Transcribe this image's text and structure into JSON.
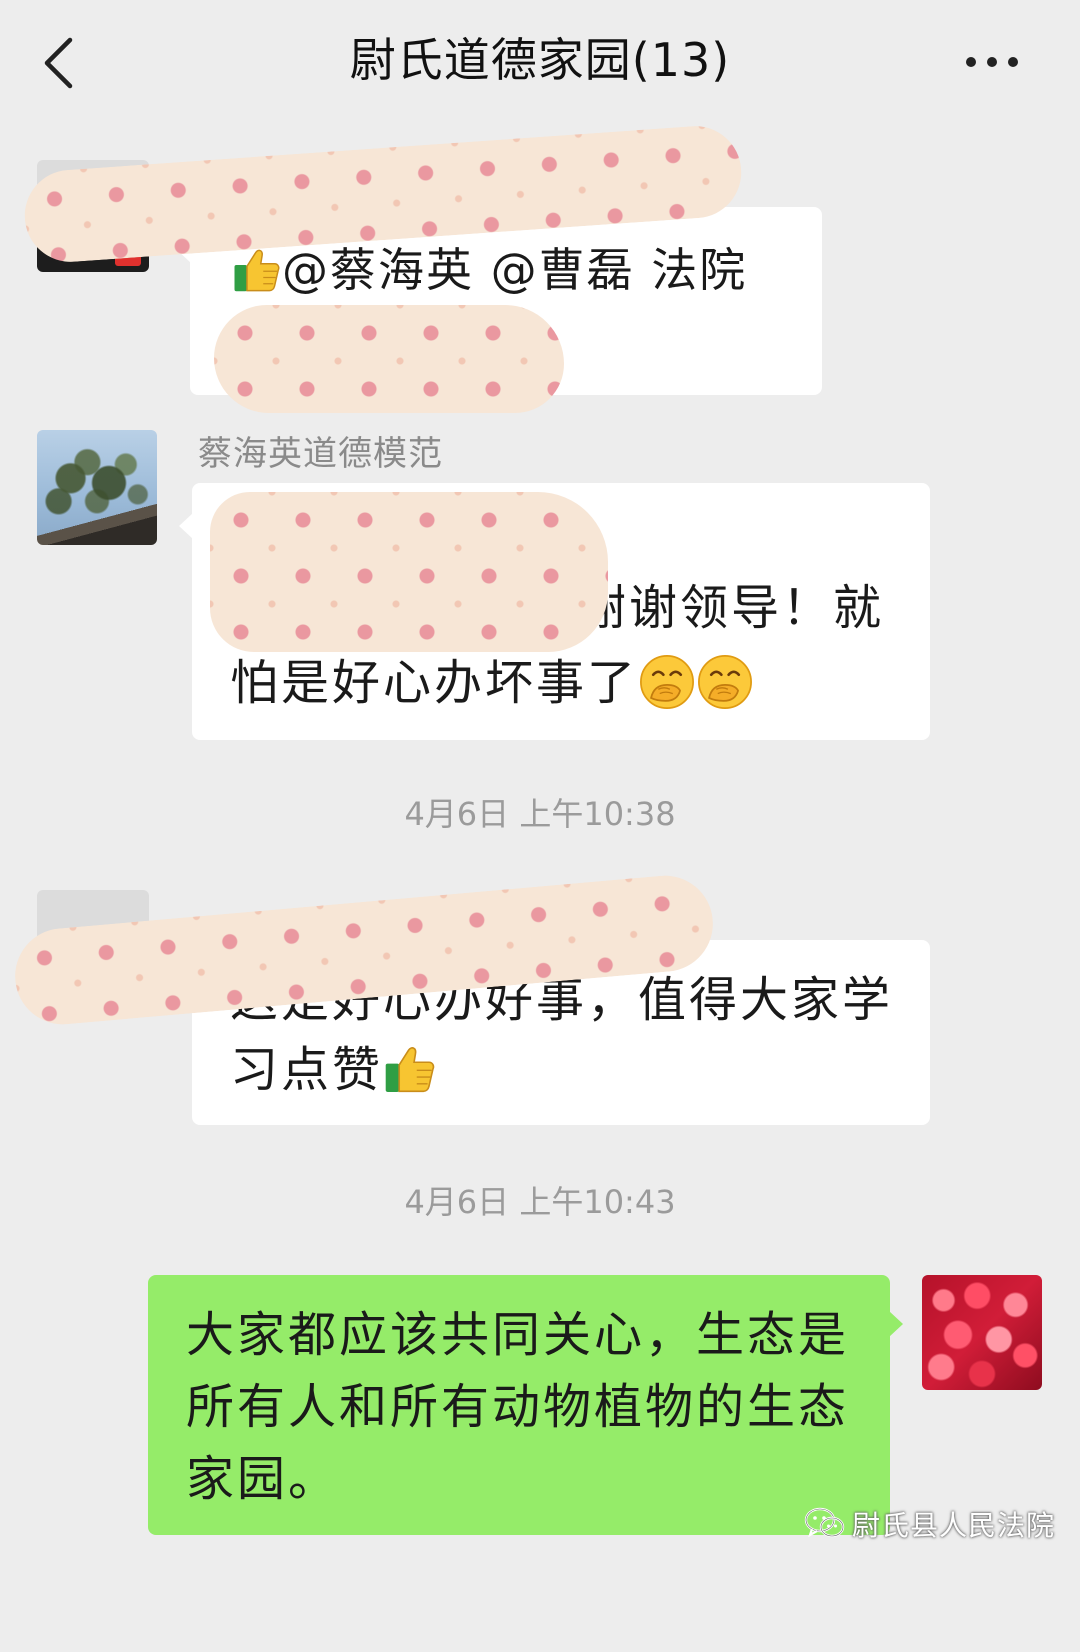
{
  "colors": {
    "background": "#ededed",
    "bubble_received": "#ffffff",
    "bubble_sent": "#95ec69",
    "timestamp": "#9b9b9b",
    "sender_name": "#8a8a8a"
  },
  "header": {
    "title": "尉氏道德家园(13)",
    "back_icon": "chevron-left-icon",
    "more_icon": "more-dots-icon"
  },
  "messages": [
    {
      "side": "received",
      "avatar": "redacted-avatar",
      "prefix_icon": "thumbs-up-icon",
      "lines": [
        "@蔡海英 @曹磊 法院"
      ]
    },
    {
      "side": "received",
      "sender_name": "蔡海英道德模范",
      "avatar": "tree-sky-photo-avatar",
      "lines": [
        "谢谢领导！就",
        "怕是好心办坏事了"
      ],
      "suffix_icons": [
        "face-with-hand-over-mouth-icon",
        "face-with-hand-over-mouth-icon"
      ]
    },
    {
      "side": "received",
      "avatar": "redacted-avatar",
      "lines": [
        "这是好心办好事，值得大家学",
        "习点赞"
      ],
      "suffix_icon": "thumbs-up-icon"
    },
    {
      "side": "sent",
      "avatar": "red-flowers-photo-avatar",
      "lines": [
        "大家都应该共同关心，生态是",
        "所有人和所有动物植物的生态",
        "家园。"
      ]
    }
  ],
  "timestamps": [
    "4月6日 上午10:38",
    "4月6日 上午10:43"
  ],
  "watermark": {
    "icon": "wechat-icon",
    "text": "尉氏县人民法院"
  }
}
